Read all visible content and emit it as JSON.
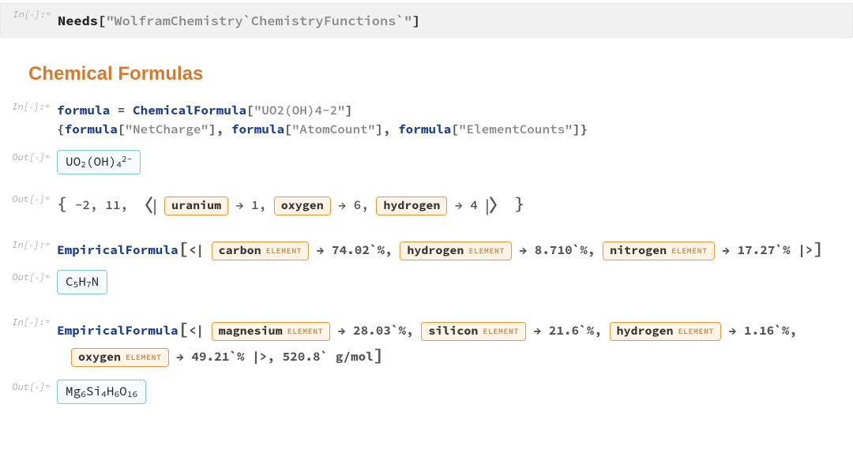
{
  "labels": {
    "in": "In[",
    "out": "Out[",
    "close": "]:="
  },
  "needs": {
    "fn": "Needs",
    "arg": "\"WolframChemistry`ChemistryFunctions`\""
  },
  "section_title": "Chemical Formulas",
  "cf": {
    "in1_a": "formula",
    "in1_eq": " = ",
    "in1_fn": "ChemicalFormula",
    "in1_arg": "\"UO2(OH)4-2\"",
    "in1_line2_open": "{",
    "in1_line2_close": "}",
    "in1_call_formula": "formula",
    "in1_keys": [
      "\"NetCharge\"",
      "\"AtomCount\"",
      "\"ElementCounts\""
    ],
    "out1_formula": {
      "a": "UO",
      "b": "2",
      "c": "(OH)",
      "d": "4",
      "sup": "2−"
    },
    "out2": {
      "open": "{",
      "close": "}",
      "net_charge": "−2",
      "atom_count": "11",
      "elements": [
        {
          "name": "uranium",
          "n": "1"
        },
        {
          "name": "oxygen",
          "n": "6"
        },
        {
          "name": "hydrogen",
          "n": "4"
        }
      ]
    }
  },
  "emp1": {
    "fn": "EmpiricalFormula",
    "items": [
      {
        "name": "carbon",
        "val": "74.02`%"
      },
      {
        "name": "hydrogen",
        "val": "8.710`%"
      },
      {
        "name": "nitrogen",
        "val": "17.27`%"
      }
    ],
    "out": {
      "a": "C",
      "as": "5",
      "b": "H",
      "bs": "7",
      "c": "N"
    }
  },
  "emp2": {
    "fn": "EmpiricalFormula",
    "items": [
      {
        "name": "magnesium",
        "val": "28.03`%"
      },
      {
        "name": "silicon",
        "val": "21.6`%"
      },
      {
        "name": "hydrogen",
        "val": "1.16`%"
      },
      {
        "name": "oxygen",
        "val": "49.21`%"
      }
    ],
    "tail": "520.8` g/mol",
    "out": {
      "a": "Mg",
      "as": "6",
      "b": "Si",
      "bs": "4",
      "c": "H",
      "cs": "6",
      "d": "O",
      "ds": "16"
    }
  },
  "glyphs": {
    "arrow": "→",
    "langle": "〈",
    "rangle": "〉",
    "labar": "|",
    "elem": "ELEMENT"
  }
}
